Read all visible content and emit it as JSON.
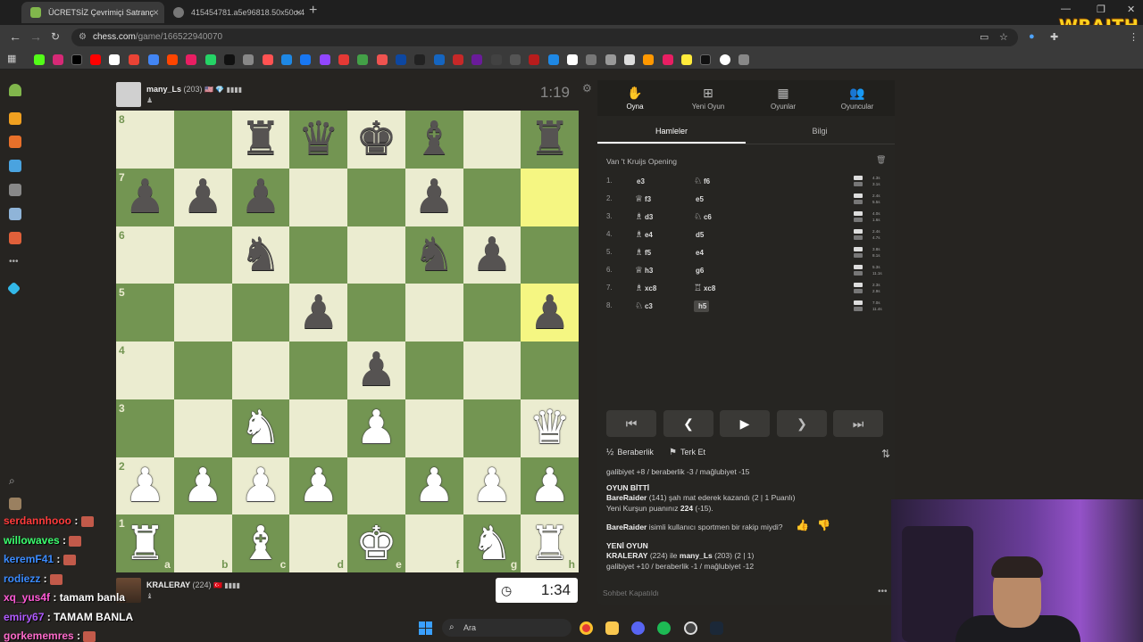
{
  "browser": {
    "tabs": [
      {
        "title": "ÜCRETSİZ Çevrimiçi Satranç"
      },
      {
        "title": "415454781.a5e96818.50x50o.4"
      }
    ],
    "url_site": "chess.com",
    "url_path": "/game/166522940070"
  },
  "overlay_brand": "WRAITH",
  "game": {
    "top_player": {
      "name": "many_Ls",
      "rating": "(203)",
      "flags": "🇺🇸 💎 ▮▮▮▮",
      "clock": "1:19"
    },
    "bottom_player": {
      "name": "KRALERAY",
      "rating": "(224)",
      "flags": "🇹🇷 ▮▮▮▮",
      "clock": "1:34"
    }
  },
  "board": {
    "rows": [
      [
        "",
        "",
        "r",
        "q",
        "k",
        "b",
        "",
        "r"
      ],
      [
        "p",
        "p",
        "p",
        "",
        "",
        "p",
        "",
        ""
      ],
      [
        "",
        "",
        "n",
        "",
        "",
        "n",
        "p",
        ""
      ],
      [
        "",
        "",
        "",
        "p",
        "",
        "",
        "",
        "p"
      ],
      [
        "",
        "",
        "",
        "",
        "p",
        "",
        "",
        ""
      ],
      [
        "",
        "",
        "N",
        "",
        "P",
        "",
        "",
        "Q"
      ],
      [
        "P",
        "P",
        "P",
        "P",
        "",
        "P",
        "P",
        "P"
      ],
      [
        "R",
        "",
        "B",
        "",
        "K",
        "",
        "N",
        "R"
      ]
    ],
    "highlights": [
      "h7",
      "h5"
    ],
    "ranks": [
      "8",
      "7",
      "6",
      "5",
      "4",
      "3",
      "2",
      "1"
    ],
    "files": [
      "a",
      "b",
      "c",
      "d",
      "e",
      "f",
      "g",
      "h"
    ]
  },
  "panel": {
    "tabs": [
      {
        "label": "Oyna",
        "icon": "play-hand-icon"
      },
      {
        "label": "Yeni Oyun",
        "icon": "plus-square-icon"
      },
      {
        "label": "Oyunlar",
        "icon": "board-icon"
      },
      {
        "label": "Oyuncular",
        "icon": "players-icon"
      }
    ],
    "subtabs": [
      "Hamleler",
      "Bilgi"
    ],
    "opening": "Van 't Kruijs Opening",
    "moves": [
      {
        "n": "1.",
        "w": "e3",
        "wf": "",
        "b": "f6",
        "bf": "♘",
        "tw": "4.3s",
        "tb": "3.1s"
      },
      {
        "n": "2.",
        "w": "f3",
        "wf": "♕",
        "b": "e5",
        "bf": "",
        "tw": "2.4s",
        "tb": "5.5s"
      },
      {
        "n": "3.",
        "w": "d3",
        "wf": "♗",
        "b": "c6",
        "bf": "♘",
        "tw": "4.0s",
        "tb": "1.6s"
      },
      {
        "n": "4.",
        "w": "e4",
        "wf": "♗",
        "b": "d5",
        "bf": "",
        "tw": "2.4s",
        "tb": "4.7s"
      },
      {
        "n": "5.",
        "w": "f5",
        "wf": "♗",
        "b": "e4",
        "bf": "",
        "tw": "3.8s",
        "tb": "8.1s"
      },
      {
        "n": "6.",
        "w": "h3",
        "wf": "♕",
        "b": "g6",
        "bf": "",
        "tw": "5.3s",
        "tb": "11.1s"
      },
      {
        "n": "7.",
        "w": "xc8",
        "wf": "♗",
        "b": "xc8",
        "bf": "♖",
        "tw": "2.3s",
        "tb": "2.9s"
      },
      {
        "n": "8.",
        "w": "c3",
        "wf": "♘",
        "b": "h5",
        "bf": "",
        "tw": "7.0s",
        "tb": "11.4s"
      }
    ],
    "actions": {
      "draw": "Beraberlik",
      "resign": "Terk Et",
      "draw_icon": "½"
    },
    "chat": {
      "line1": "galibiyet +8 / beraberlik -3 / mağlubiyet -15",
      "over_title": "OYUN BİTTİ",
      "over_line1_name": "BareRaider",
      "over_line1_rest": " (141) şah mat ederek kazandı (2 | 1 Puanlı)",
      "over_line2_pre": "Yeni Kurşun puanınız ",
      "over_line2_num": "224",
      "over_line2_post": " (-15).",
      "question_name": "BareRaider",
      "question_rest": " isimli kullanıcı sportmen bir rakip miydi?",
      "new_title": "YENİ OYUN",
      "new_line1_a": "KRALERAY",
      "new_line1_b": " (224) ile ",
      "new_line1_c": "many_Ls",
      "new_line1_d": " (203) (2 | 1)",
      "new_line2": "galibiyet +10 / beraberlik -1 / mağlubiyet -12",
      "chat_off": "Sohbet Kapatıldı"
    }
  },
  "stream_chat": [
    {
      "user": "serdannhooo",
      "msg": "",
      "color": "#ff3b3b"
    },
    {
      "user": "willowaves",
      "msg": "",
      "color": "#3bff6e"
    },
    {
      "user": "keremF41",
      "msg": "",
      "color": "#3b8bff"
    },
    {
      "user": "rodiezz",
      "msg": "",
      "color": "#3b8bff"
    },
    {
      "user": "xq_yus4f",
      "msg": "tamam banla",
      "color": "#ff5ad6"
    },
    {
      "user": "emiry67",
      "msg": "TAMAM BANLA",
      "color": "#b05aff"
    },
    {
      "user": "gorkememres",
      "msg": "",
      "color": "#ff6bcb"
    }
  ],
  "taskbar": {
    "search": "Ara"
  },
  "colors": {
    "board_light": "#ebecd0",
    "board_dark": "#739552",
    "highlight": "#f5f682",
    "panel_bg": "#262522"
  }
}
